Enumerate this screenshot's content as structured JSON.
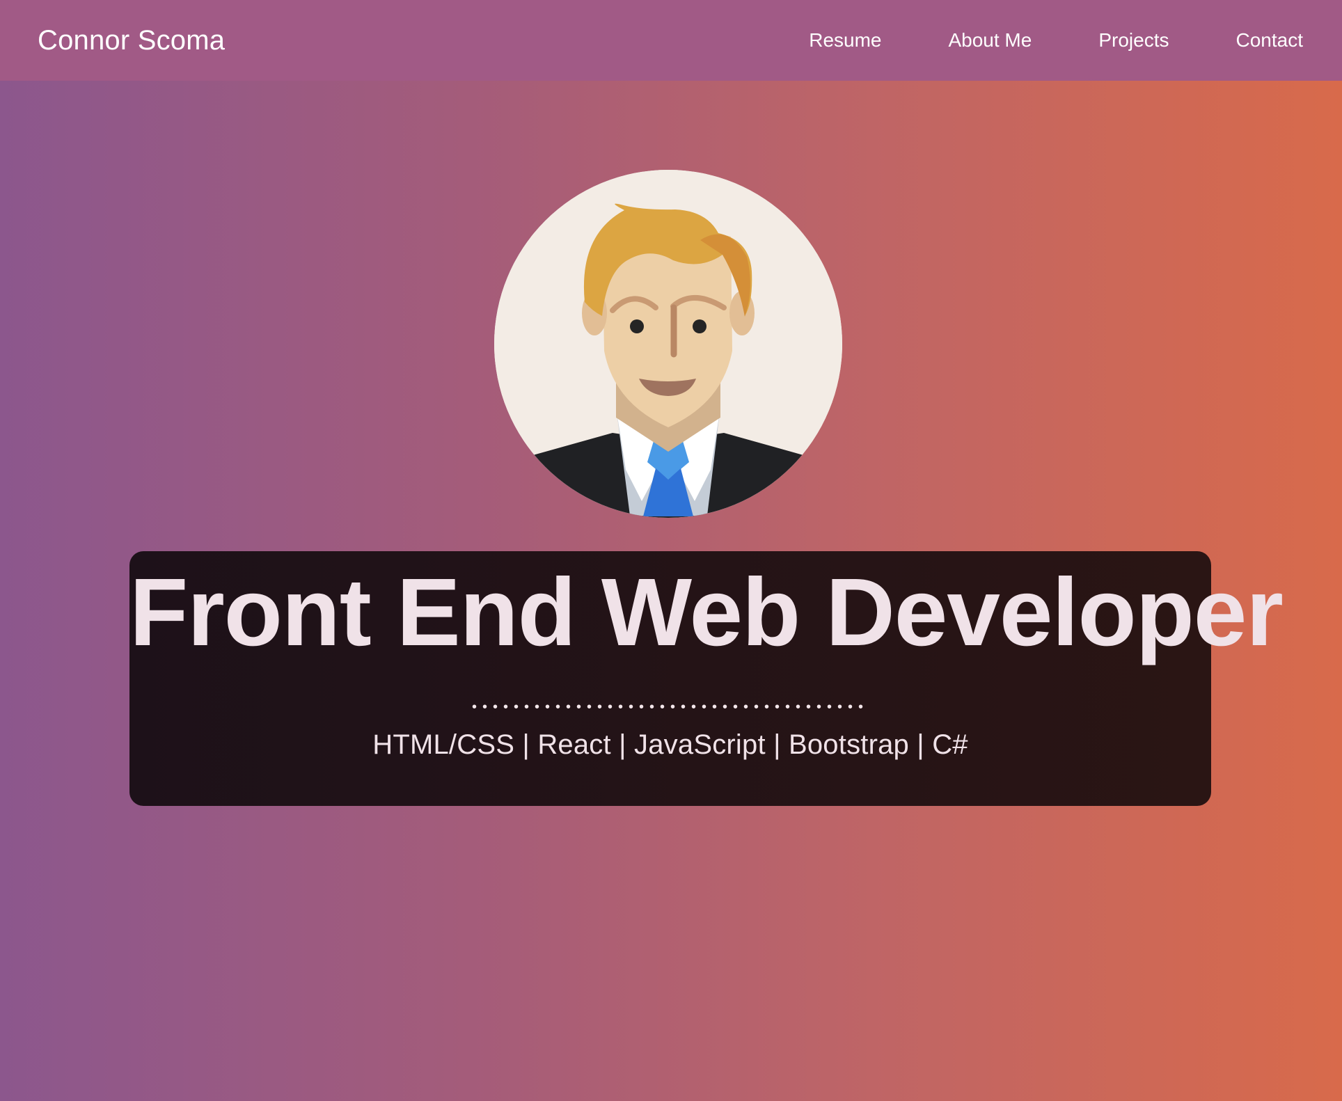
{
  "nav": {
    "brand": "Connor Scoma",
    "links": [
      {
        "label": "Resume"
      },
      {
        "label": "About Me"
      },
      {
        "label": "Projects"
      },
      {
        "label": "Contact"
      }
    ]
  },
  "hero": {
    "avatar_icon": "businessman-avatar-icon",
    "title": "Front End Web Developer",
    "divider": "••••••••••••••••••••••••••••••••••••••",
    "skills": "HTML/CSS | React | JavaScript | Bootstrap | C#"
  },
  "colors": {
    "navbar": "#a15a86",
    "background_start": "#8c578d",
    "background_end": "#d86a4b",
    "card": "#1d1119",
    "text": "#f0e2e8"
  }
}
